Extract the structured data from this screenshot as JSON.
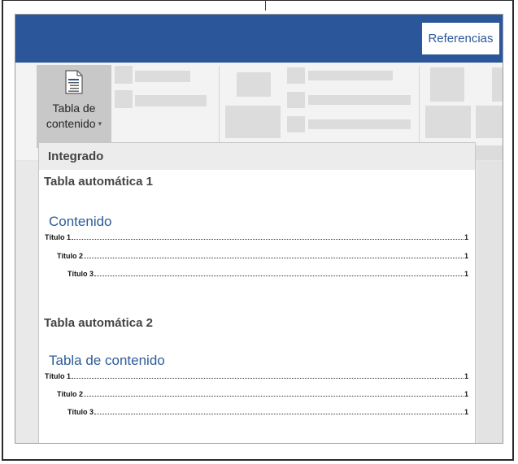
{
  "ribbon": {
    "tab_referencias": "Referencias",
    "toc_button": {
      "line1": "Tabla de",
      "line2": "contenido",
      "caret": "▾",
      "icon": "document-toc-icon"
    }
  },
  "dropdown": {
    "section_header": "Integrado",
    "items": [
      {
        "title": "Tabla automática 1",
        "heading": "Contenido",
        "entries": [
          {
            "text": "Título 1",
            "page": "1"
          },
          {
            "text": "Título 2",
            "page": "1"
          },
          {
            "text": "Título 3",
            "page": "1"
          }
        ]
      },
      {
        "title": "Tabla automática 2",
        "heading": "Tabla de contenido",
        "entries": [
          {
            "text": "Título 1",
            "page": "1"
          },
          {
            "text": "Título 2",
            "page": "1"
          },
          {
            "text": "Título 3",
            "page": "1"
          }
        ]
      }
    ]
  },
  "colors": {
    "title_bar": "#2b579a",
    "toc_heading": "#2e5c99",
    "selected_button": "#c8c8c8"
  }
}
